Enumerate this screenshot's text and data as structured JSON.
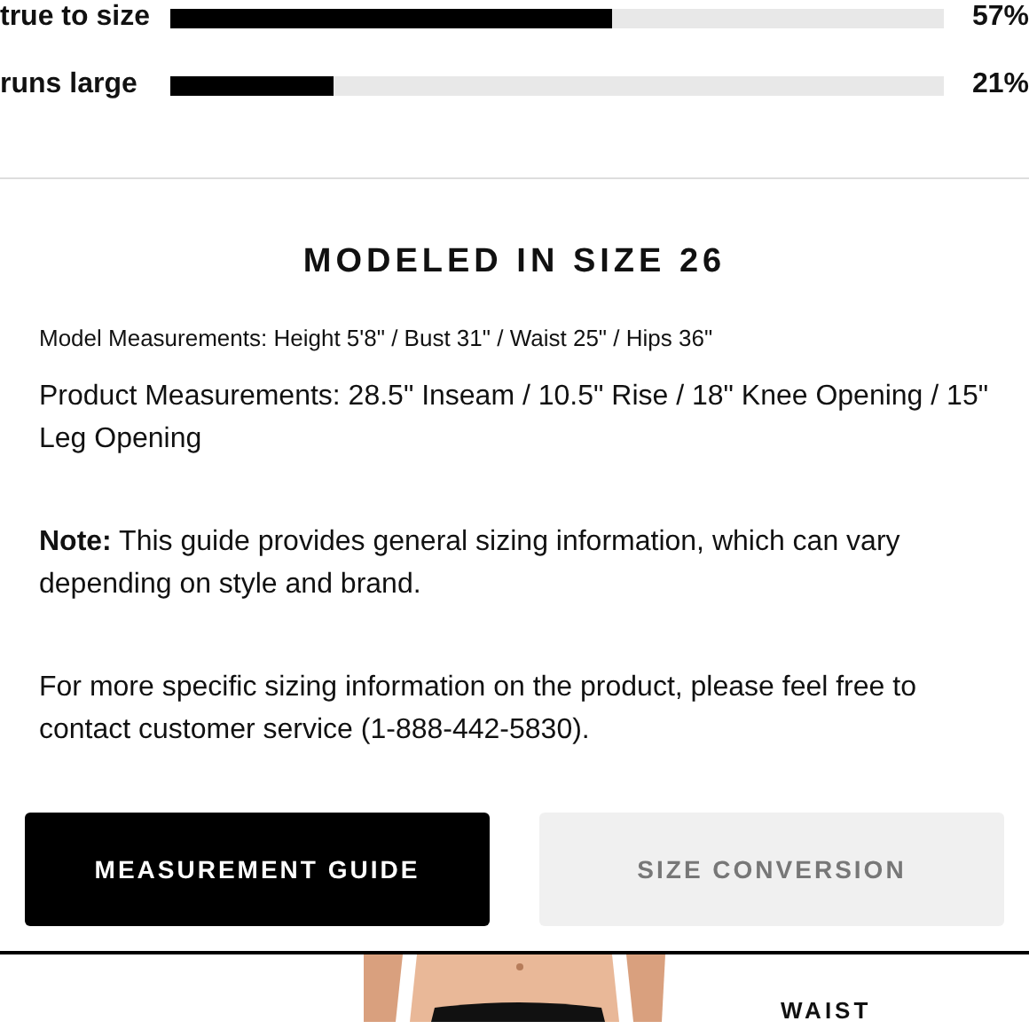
{
  "fit_ratings": [
    {
      "label": "true to size",
      "level": 0.57,
      "percent": "57%"
    },
    {
      "label": "runs large",
      "level": 0.21,
      "percent": "21%"
    }
  ],
  "model": {
    "heading": "MODELED IN SIZE 26",
    "model_measurements": "Model Measurements: Height 5'8\" / Bust 31\" / Waist 25\" / Hips 36\"",
    "product_measurements": "Product Measurements: 28.5\" Inseam / 10.5\" Rise / 18\" Knee Opening / 15\" Leg Opening",
    "note": "**Note:** This guide provides general sizing information, which can vary depending on style and brand.",
    "contact": "For more specific sizing information on the product, please feel free to contact customer service (1-888-442-5830)."
  },
  "buttons": [
    {
      "label": "MEASUREMENT GUIDE",
      "selected": true
    },
    {
      "label": "SIZE CONVERSION",
      "selected": false
    }
  ],
  "size_chart": {
    "label": "WAIST"
  }
}
